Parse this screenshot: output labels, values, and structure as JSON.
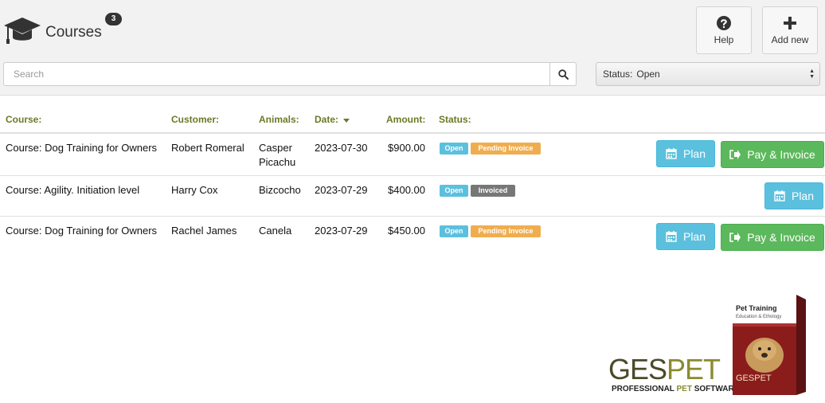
{
  "header": {
    "title": "Courses",
    "count": "3",
    "help_label": "Help",
    "add_label": "Add new"
  },
  "search": {
    "placeholder": "Search",
    "value": ""
  },
  "status_filter": {
    "label": "Status:",
    "value": "Open"
  },
  "columns": {
    "course": "Course:",
    "customer": "Customer:",
    "animals": "Animals:",
    "date": "Date:",
    "amount": "Amount:",
    "status": "Status:"
  },
  "rows": [
    {
      "course": "Course: Dog Training for Owners",
      "customer": "Robert Romeral",
      "animals_1": "Casper",
      "animals_2": "Picachu",
      "date": "2023-07-30",
      "amount": "$900.00",
      "status": "Open",
      "invoice_status": "Pending Invoice",
      "plan_label": "Plan",
      "pay_label": "Pay & Invoice"
    },
    {
      "course": "Course: Agility. Initiation level",
      "customer": "Harry Cox",
      "animals_1": "Bizcocho",
      "date": "2023-07-29",
      "amount": "$400.00",
      "status": "Open",
      "invoice_status": "Invoiced",
      "plan_label": "Plan"
    },
    {
      "course": "Course: Dog Training for Owners",
      "customer": "Rachel James",
      "animals_1": "Canela",
      "date": "2023-07-29",
      "amount": "$450.00",
      "status": "Open",
      "invoice_status": "Pending Invoice",
      "plan_label": "Plan",
      "pay_label": "Pay & Invoice"
    }
  ],
  "logo": {
    "part1": "GES",
    "part2": "PET",
    "tagline_1": "PROFESSIONAL ",
    "tagline_2": "PET",
    "tagline_3": " SOFTWARE"
  },
  "product_box": {
    "title": "Pet Training",
    "subtitle": "Education & Ethology",
    "brand": "GESPET"
  },
  "colors": {
    "header_text": "#6b7a26",
    "info": "#5bc0de",
    "success": "#5cb85c",
    "warning": "#f0ad4e",
    "default": "#777777"
  }
}
